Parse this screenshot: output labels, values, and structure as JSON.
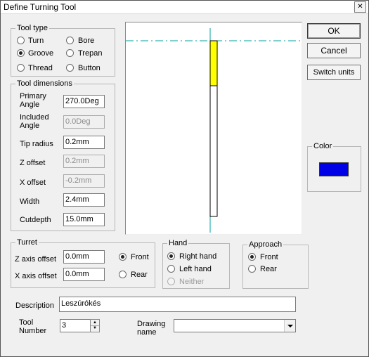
{
  "window": {
    "title": "Define Turning Tool",
    "close_glyph": "✕"
  },
  "tool_type": {
    "title": "Tool type",
    "options": [
      "Turn",
      "Bore",
      "Groove",
      "Trepan",
      "Thread",
      "Button"
    ],
    "selected": "Groove"
  },
  "tool_dimensions": {
    "title": "Tool dimensions",
    "primary_angle": {
      "label": "Primary Angle",
      "value": "270.0Deg"
    },
    "included_angle": {
      "label": "Included Angle",
      "value": "0.0Deg"
    },
    "tip_radius": {
      "label": "Tip radius",
      "value": "0.2mm"
    },
    "z_offset": {
      "label": "Z offset",
      "value": "0.2mm"
    },
    "x_offset": {
      "label": "X offset",
      "value": "-0.2mm"
    },
    "width": {
      "label": "Width",
      "value": "2.4mm"
    },
    "cutdepth": {
      "label": "Cutdepth",
      "value": "15.0mm"
    }
  },
  "buttons": {
    "ok": "OK",
    "cancel": "Cancel",
    "switch_units": "Switch units"
  },
  "color": {
    "title": "Color",
    "value": "#0000e6"
  },
  "turret": {
    "title": "Turret",
    "z_axis_offset": {
      "label": "Z axis offset",
      "value": "0.0mm"
    },
    "x_axis_offset": {
      "label": "X axis offset",
      "value": "0.0mm"
    },
    "front_label": "Front",
    "rear_label": "Rear",
    "selected": "Front"
  },
  "hand": {
    "title": "Hand",
    "right_label": "Right hand",
    "left_label": "Left hand",
    "neither_label": "Neither",
    "selected": "Right hand"
  },
  "approach": {
    "title": "Approach",
    "front_label": "Front",
    "rear_label": "Rear",
    "selected": "Front"
  },
  "description": {
    "label": "Description",
    "value": "Leszúrókés"
  },
  "tool_number": {
    "label": "Tool Number",
    "value": "3"
  },
  "drawing_name": {
    "label": "Drawing name",
    "value": ""
  },
  "preview_colors": {
    "centerline": "#00a0a0",
    "tool_tip": "#ffff00"
  }
}
